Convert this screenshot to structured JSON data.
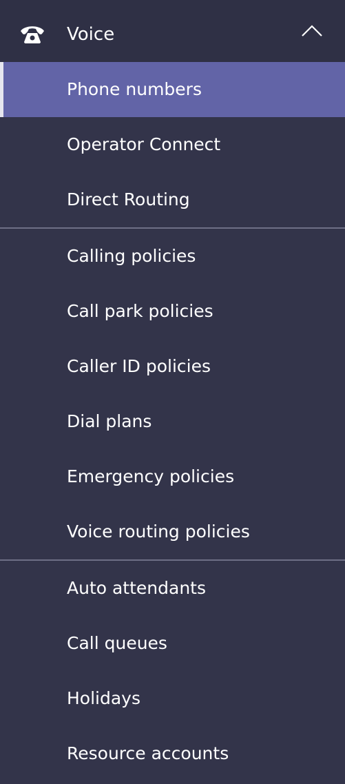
{
  "section": {
    "title": "Voice",
    "icon": "phone-icon",
    "chevron": "chevron-up-icon",
    "expanded": true
  },
  "groups": [
    {
      "items": [
        {
          "label": "Phone numbers",
          "selected": true
        },
        {
          "label": "Operator Connect",
          "selected": false
        },
        {
          "label": "Direct Routing",
          "selected": false
        }
      ]
    },
    {
      "items": [
        {
          "label": "Calling policies",
          "selected": false
        },
        {
          "label": "Call park policies",
          "selected": false
        },
        {
          "label": "Caller ID policies",
          "selected": false
        },
        {
          "label": "Dial plans",
          "selected": false
        },
        {
          "label": "Emergency policies",
          "selected": false
        },
        {
          "label": "Voice routing policies",
          "selected": false
        }
      ]
    },
    {
      "items": [
        {
          "label": "Auto attendants",
          "selected": false
        },
        {
          "label": "Call queues",
          "selected": false
        },
        {
          "label": "Holidays",
          "selected": false
        },
        {
          "label": "Resource accounts",
          "selected": false
        }
      ]
    }
  ],
  "colors": {
    "background": "#33344a",
    "header_background": "#2f3045",
    "selected_background": "#6264a7",
    "divider": "#6e6f86",
    "text": "#ffffff"
  }
}
